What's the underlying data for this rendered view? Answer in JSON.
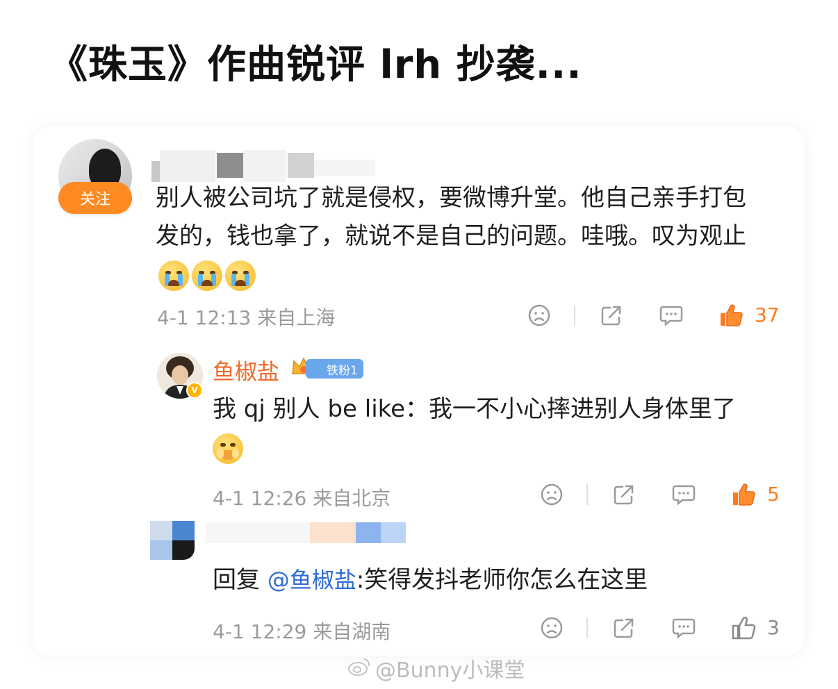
{
  "headline": "《珠玉》作曲锐评 lrh 抄袭...",
  "comments": [
    {
      "follow_label": "关注",
      "text": "别人被公司坑了就是侵权，要微博升堂。他自己亲手打包发的，钱也拿了，就说不是自己的问题。哇哦。叹为观止",
      "emoji_count": 3,
      "meta": "4-1 12:13 来自上海",
      "likes": "37"
    },
    {
      "username": "鱼椒盐",
      "fan_badge": "铁粉1",
      "text": "我 qj 别人 be like：我一不小心摔进别人身体里了",
      "meta": "4-1 12:26 来自北京",
      "likes": "5"
    },
    {
      "reply_prefix": "回复",
      "mention": "@鱼椒盐",
      "text": ":笑得发抖老师你怎么在这里",
      "meta": "4-1 12:29 来自湖南",
      "likes": "3"
    }
  ],
  "watermark": "@Bunny小课堂",
  "icons": [
    "sad-face-icon",
    "share-icon",
    "comment-icon",
    "thumbs-up-icon"
  ],
  "colors": {
    "accent_orange": "#ff7a1a",
    "follow_badge": "#ff8a21",
    "username": "#ef6a2b",
    "mention": "#2d6bd6",
    "fan_badge": "#6aa6ec",
    "meta_gray": "#9b9b9b"
  }
}
